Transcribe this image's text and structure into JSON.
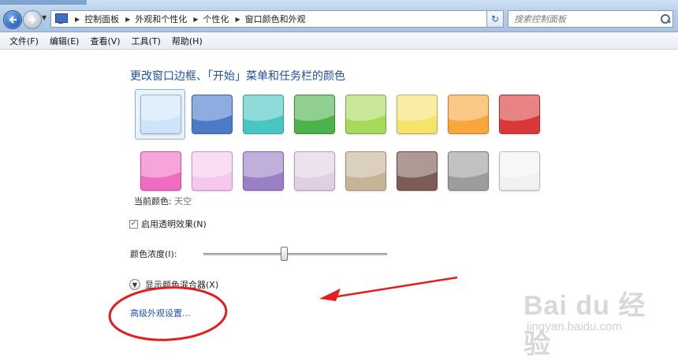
{
  "nav": {
    "breadcrumbs": [
      "控制面板",
      "外观和个性化",
      "个性化",
      "窗口颜色和外观"
    ],
    "search_placeholder": "搜索控制面板"
  },
  "menu": {
    "items": [
      "文件(F)",
      "编辑(E)",
      "查看(V)",
      "工具(T)",
      "帮助(H)"
    ]
  },
  "main": {
    "heading": "更改窗口边框、「开始」菜单和任务栏的颜色",
    "colors": [
      {
        "name": "天空",
        "hex": "#cfe4fb",
        "selected": true
      },
      {
        "hex": "#4a7ac8"
      },
      {
        "hex": "#49c6c2"
      },
      {
        "hex": "#4cb24c"
      },
      {
        "hex": "#a6d95a"
      },
      {
        "hex": "#f6e36b"
      },
      {
        "hex": "#f9a63c"
      },
      {
        "hex": "#d8383a"
      },
      {
        "hex": "#f06cc3"
      },
      {
        "hex": "#f6c8ee"
      },
      {
        "hex": "#9b7fc6"
      },
      {
        "hex": "#e1cfe6"
      },
      {
        "hex": "#c6b496"
      },
      {
        "hex": "#7d5c55"
      },
      {
        "hex": "#9d9d9d"
      },
      {
        "hex": "#f2f2f2"
      }
    ],
    "current_color_label": "当前颜色:",
    "current_color_value": "天空",
    "transparency_label": "启用透明效果(N)",
    "transparency_checked": true,
    "intensity_label": "颜色浓度(I):",
    "intensity_value": 0.42,
    "mixer_label": "显示颜色混合器(X)",
    "advanced_link": "高级外观设置..."
  },
  "watermark": {
    "brand": "Bai du 经验",
    "url": "jingyan.baidu.com"
  },
  "colors": {
    "heading": "#1e4fa8",
    "link": "#1f52b8",
    "annotation": "#e41e1e"
  }
}
